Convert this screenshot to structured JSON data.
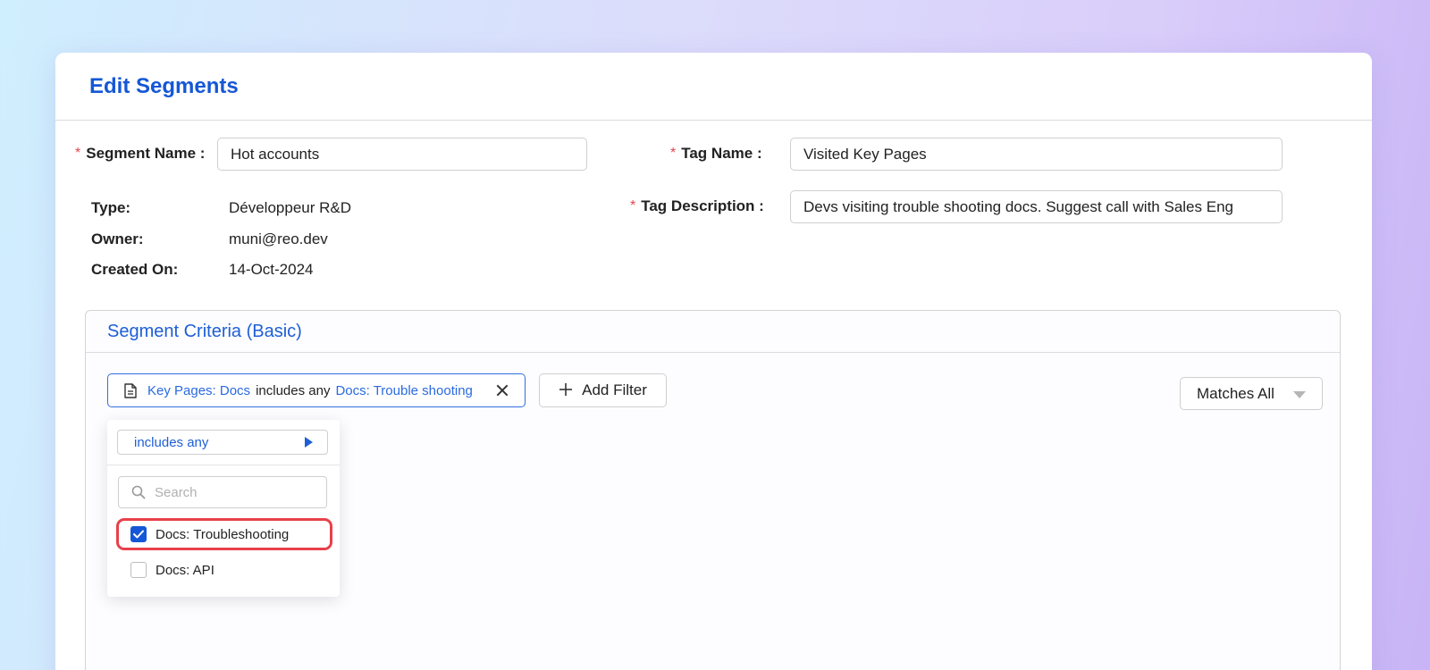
{
  "page": {
    "title": "Edit Segments"
  },
  "segment": {
    "name_label": "Segment Name :",
    "name_value": "Hot accounts",
    "type_label": "Type:",
    "type_value": "Développeur R&D",
    "owner_label": "Owner:",
    "owner_value": "muni@reo.dev",
    "created_label": "Created On:",
    "created_value": "14-Oct-2024"
  },
  "tag": {
    "name_label": "Tag Name :",
    "name_value": "Visited Key Pages",
    "description_label": "Tag Description :",
    "description_value": "Devs visiting trouble shooting docs. Suggest call with Sales Eng"
  },
  "required_marker": "*",
  "criteria": {
    "title": "Segment Criteria (Basic)",
    "filter_chip": {
      "field": "Key Pages: Docs",
      "operator": "includes any",
      "value": "Docs: Trouble shooting"
    },
    "add_filter_label": "Add Filter",
    "match_mode": "Matches All"
  },
  "dropdown": {
    "operator": "includes any",
    "search_placeholder": "Search",
    "options": [
      {
        "label": "Docs: Troubleshooting",
        "checked": true
      },
      {
        "label": "Docs: API",
        "checked": false
      }
    ]
  },
  "colors": {
    "brand_blue": "#1557d6",
    "required_red": "#e0454f",
    "highlight_red": "#e8414a"
  },
  "icons": {
    "filter_chip": "document-icon",
    "remove": "close-icon",
    "add": "plus-icon",
    "match_caret": "chevron-down-icon",
    "operator_caret": "caret-right-icon",
    "search": "search-icon",
    "check": "checkmark-icon"
  }
}
